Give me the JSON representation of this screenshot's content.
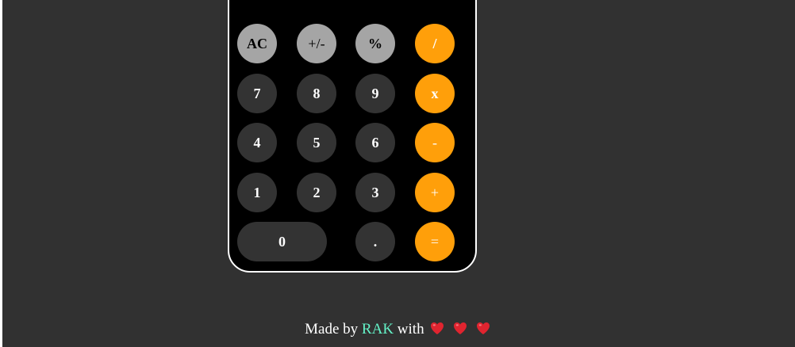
{
  "calculator": {
    "rows": [
      [
        {
          "label": "AC",
          "kind": "func"
        },
        {
          "label": "+/-",
          "kind": "func"
        },
        {
          "label": "%",
          "kind": "func"
        },
        {
          "label": "/",
          "kind": "op"
        }
      ],
      [
        {
          "label": "7",
          "kind": "num"
        },
        {
          "label": "8",
          "kind": "num"
        },
        {
          "label": "9",
          "kind": "num"
        },
        {
          "label": "x",
          "kind": "op"
        }
      ],
      [
        {
          "label": "4",
          "kind": "num"
        },
        {
          "label": "5",
          "kind": "num"
        },
        {
          "label": "6",
          "kind": "num"
        },
        {
          "label": "-",
          "kind": "op"
        }
      ],
      [
        {
          "label": "1",
          "kind": "num"
        },
        {
          "label": "2",
          "kind": "num"
        },
        {
          "label": "3",
          "kind": "num"
        },
        {
          "label": "+",
          "kind": "op"
        }
      ],
      [
        {
          "label": "0",
          "kind": "num"
        },
        {
          "label": ".",
          "kind": "num"
        },
        {
          "label": "=",
          "kind": "op"
        }
      ]
    ]
  },
  "footer": {
    "prefix": "Made by",
    "author": "RAK",
    "suffix": "with",
    "hearts": [
      "heart-icon",
      "heart-icon",
      "heart-icon"
    ]
  },
  "colors": {
    "page_background": "#313131",
    "calculator_background": "#000000",
    "function_key": "#a5a5a5",
    "number_key": "#333333",
    "operator_key": "#ff9f0a",
    "author_link": "#64f3c8",
    "heart": "#e0242f"
  }
}
